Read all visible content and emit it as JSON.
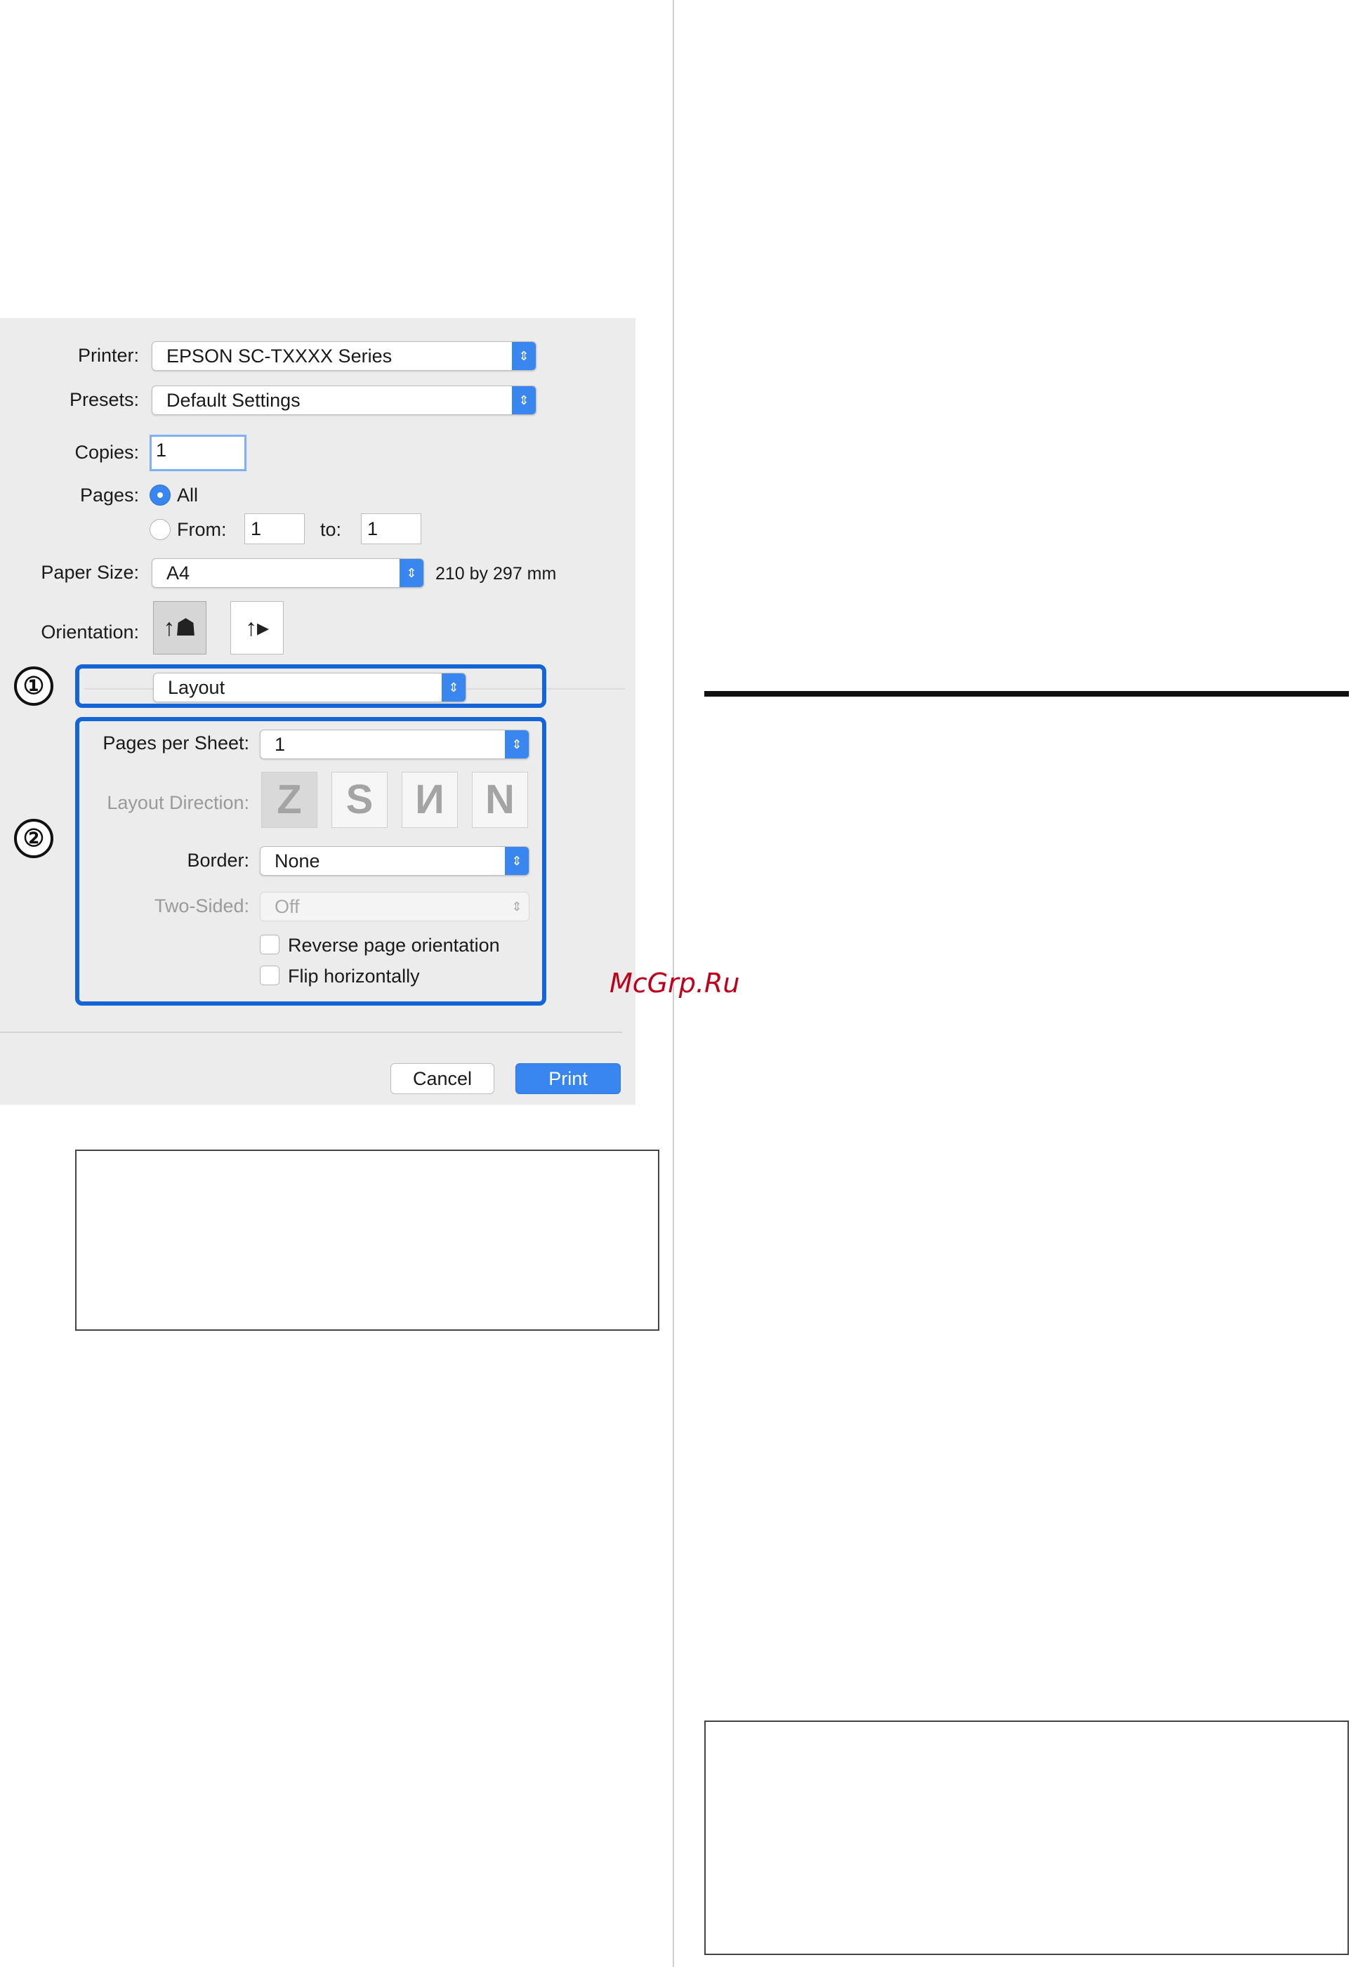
{
  "dialog": {
    "printer_label": "Printer:",
    "printer_value": "EPSON SC-TXXXX Series",
    "presets_label": "Presets:",
    "presets_value": "Default Settings",
    "copies_label": "Copies:",
    "copies_value": "1",
    "pages_label": "Pages:",
    "pages_all_label": "All",
    "pages_from_label": "From:",
    "pages_from_value": "1",
    "pages_to_label": "to:",
    "pages_to_value": "1",
    "paper_size_label": "Paper Size:",
    "paper_size_value": "A4",
    "paper_size_dims": "210 by 297 mm",
    "orientation_label": "Orientation:",
    "panel_value": "Layout",
    "pages_per_sheet_label": "Pages per Sheet:",
    "pages_per_sheet_value": "1",
    "layout_direction_label": "Layout Direction:",
    "border_label": "Border:",
    "border_value": "None",
    "two_sided_label": "Two-Sided:",
    "two_sided_value": "Off",
    "reverse_label": "Reverse page orientation",
    "flip_label": "Flip horizontally",
    "cancel_label": "Cancel",
    "print_label": "Print"
  },
  "callouts": {
    "one": "①",
    "two": "②"
  },
  "watermark": "McGrp.Ru",
  "colors": {
    "accent": "#3a86f0",
    "callout_border": "#1565d8",
    "watermark": "#c0001a"
  }
}
